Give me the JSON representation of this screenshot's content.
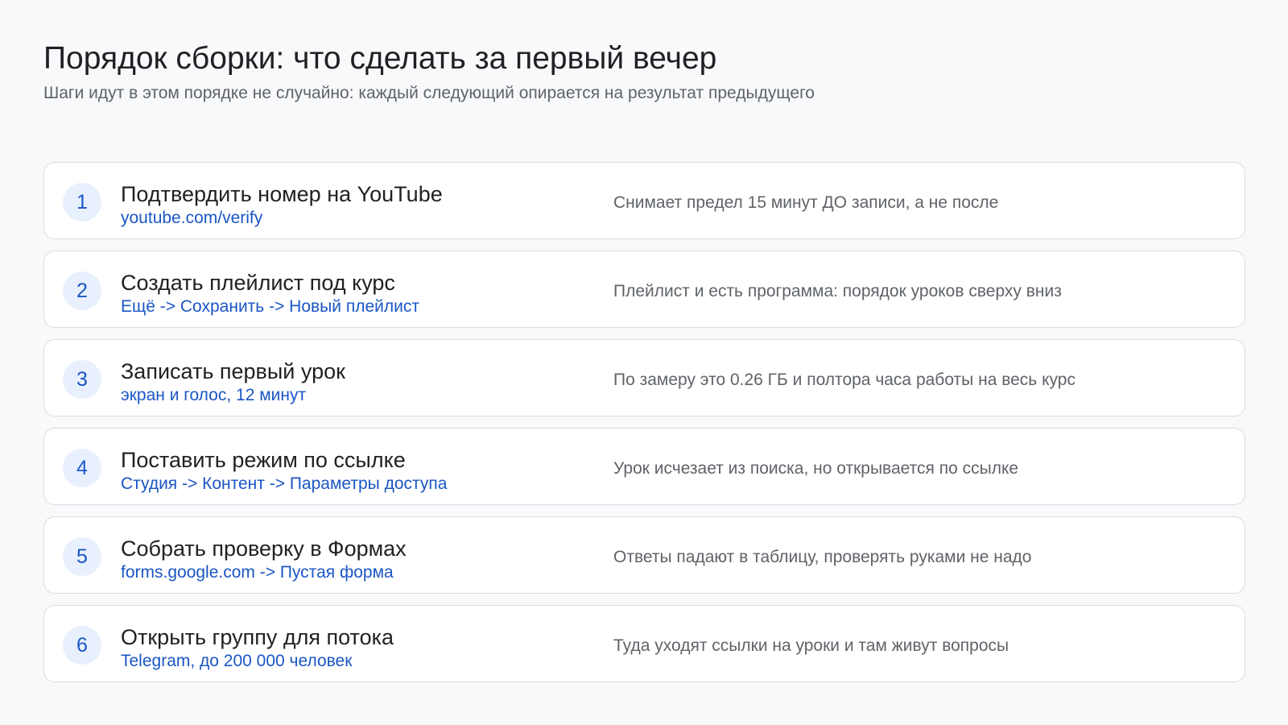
{
  "header": {
    "title": "Порядок сборки: что сделать за первый вечер",
    "subtitle": "Шаги идут в этом порядке не случайно: каждый следующий опирается на результат предыдущего"
  },
  "steps": [
    {
      "number": "1",
      "title": "Подтвердить номер на YouTube",
      "path": "youtube.com/verify",
      "note": "Снимает предел 15 минут ДО записи, а не после"
    },
    {
      "number": "2",
      "title": "Создать плейлист под курс",
      "path": "Ещё -> Сохранить -> Новый плейлист",
      "note": "Плейлист и есть программа: порядок уроков сверху вниз"
    },
    {
      "number": "3",
      "title": "Записать первый урок",
      "path": "экран и голос, 12 минут",
      "note": "По замеру это 0.26 ГБ и полтора часа работы на весь курс"
    },
    {
      "number": "4",
      "title": "Поставить режим по ссылке",
      "path": "Студия -> Контент -> Параметры доступа",
      "note": "Урок исчезает из поиска, но открывается по ссылке"
    },
    {
      "number": "5",
      "title": "Собрать проверку в Формах",
      "path": "forms.google.com -> Пустая форма",
      "note": "Ответы падают в таблицу, проверять руками не надо"
    },
    {
      "number": "6",
      "title": "Открыть группу для потока",
      "path": "Telegram, до 200 000 человек",
      "note": "Туда уходят ссылки на уроки и там живут вопросы"
    }
  ]
}
